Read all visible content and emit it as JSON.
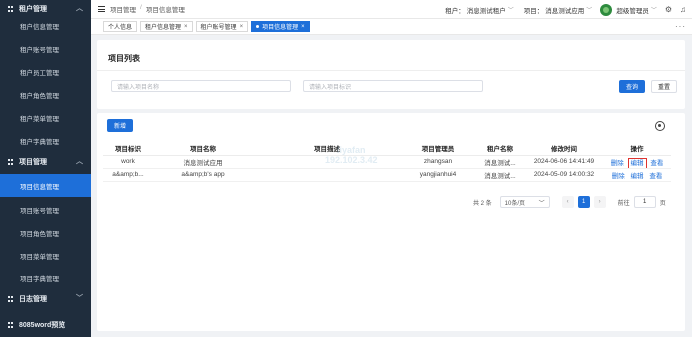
{
  "sidebar": {
    "groups": [
      {
        "label": "租户管理"
      },
      {
        "label": "项目管理"
      },
      {
        "label": "日志管理"
      },
      {
        "label": "8085word预览"
      }
    ],
    "tenant_items": [
      "租户信息管理",
      "租户账号管理",
      "租户员工管理",
      "租户角色管理",
      "租户菜单管理",
      "租户字典管理"
    ],
    "project_items": [
      "项目信息管理",
      "项目账号管理",
      "项目角色管理",
      "项目菜单管理",
      "项目字典管理"
    ]
  },
  "header": {
    "breadcrumb": [
      "项目管理",
      "项目信息管理"
    ],
    "tenant_label": "租户：",
    "tenant_value": "消息测试租户",
    "project_label": "项目：",
    "project_value": "消息测试应用",
    "user": "超级管理员"
  },
  "tabs": [
    "个人信息",
    "租户信息管理",
    "租户账号管理",
    "项目信息管理"
  ],
  "search": {
    "title": "项目列表",
    "name_placeholder": "请输入项目名称",
    "code_placeholder": "请输入项目标识",
    "query_label": "查询",
    "reset_label": "重置"
  },
  "table": {
    "add_label": "新增",
    "columns": [
      "项目标识",
      "项目名称",
      "项目描述",
      "项目管理员",
      "租户名称",
      "修改时间",
      "操作"
    ],
    "rows": [
      {
        "code": "work",
        "name": "消息测试应用",
        "desc": "",
        "admin": "zhangsan",
        "tenant": "消息测试...",
        "time": "2024-06-06 14:41:49"
      },
      {
        "code": "a&amp;b...",
        "name": "a&amp;b's app",
        "desc": "",
        "admin": "yangjianhui4",
        "tenant": "消息测试...",
        "time": "2024-05-09 14:00:32"
      }
    ],
    "actions": [
      "删除",
      "编辑",
      "查看"
    ]
  },
  "watermark": {
    "line1": "liyafan",
    "line2": "192.102.3.42"
  },
  "pagination": {
    "total": "共 2 条",
    "page_size": "10条/页",
    "current": "1",
    "goto_label": "前往",
    "goto_value": "1",
    "page_unit": "页"
  }
}
